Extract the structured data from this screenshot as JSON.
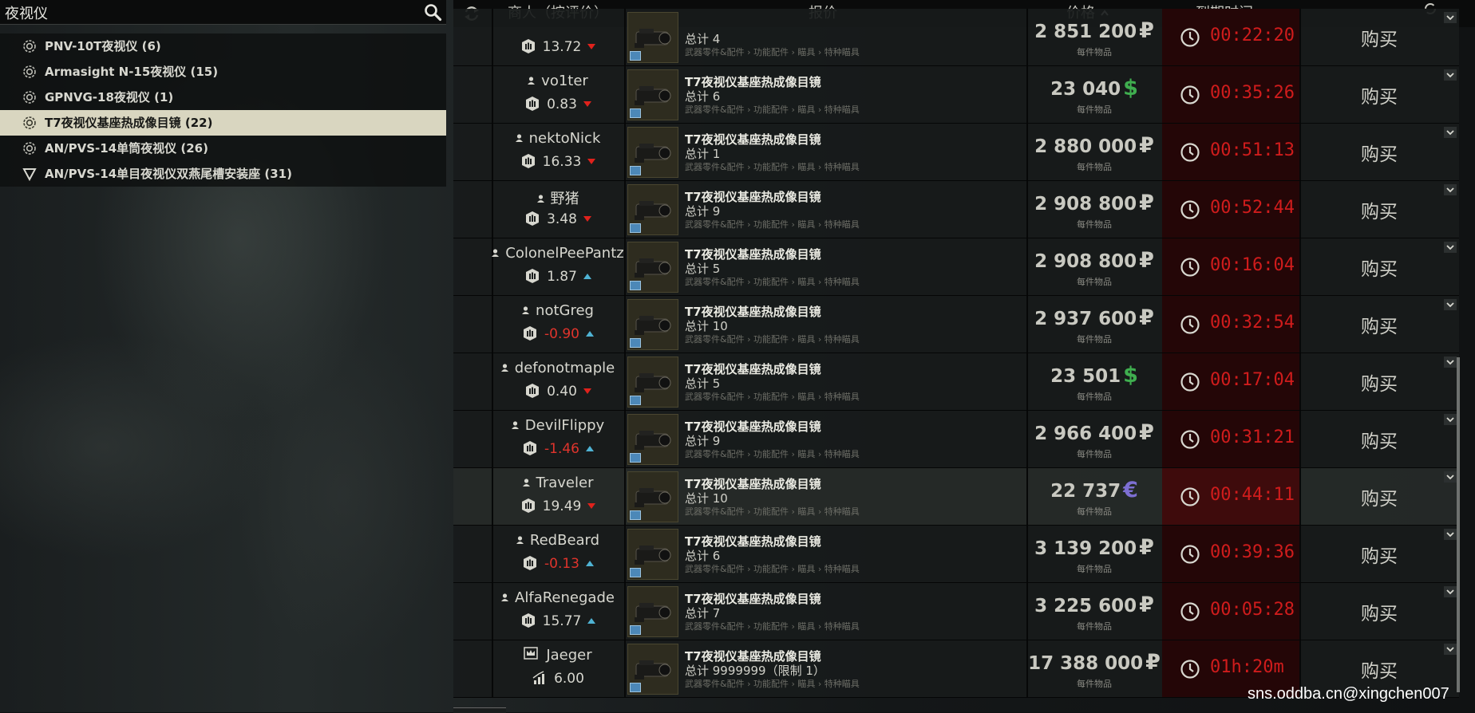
{
  "search": {
    "value": "夜视仪"
  },
  "categories": [
    {
      "label": "PNV-10T夜视仪 (6)",
      "icon": "gear-icon"
    },
    {
      "label": "Armasight N-15夜视仪 (15)",
      "icon": "gear-icon"
    },
    {
      "label": "GPNVG-18夜视仪 (1)",
      "icon": "gear-icon"
    },
    {
      "label": "T7夜视仪基座热成像目镜 (22)",
      "icon": "gear-icon",
      "selected": true
    },
    {
      "label": "AN/PVS-14单筒夜视仪 (26)",
      "icon": "gear-icon"
    },
    {
      "label": "AN/PVS-14单目夜视仪双燕尾槽安装座 (31)",
      "icon": "triangle-down-icon"
    }
  ],
  "header": {
    "trader": "商人（按评价）",
    "offer": "报价",
    "price": "价格",
    "expiry": "到期时间"
  },
  "colors": {
    "rub": "#c9c9c1",
    "usd": "#3fae4f",
    "eur": "#7d6fd2",
    "timer": "#d01c1c"
  },
  "offers": [
    {
      "trader": "",
      "rating": "13.72",
      "trend": "down",
      "negative": false,
      "item": "",
      "count": "总计 4",
      "category": "武器零件&配件 › 功能配件 › 瞄具 › 特种瞄具",
      "price": "2 851 200",
      "currency": "₽",
      "unit": "每件物品",
      "time": "00:22:20"
    },
    {
      "trader": "vo1ter",
      "rating": "0.83",
      "trend": "down",
      "negative": false,
      "item": "T7夜视仪基座热成像目镜",
      "count": "总计 6",
      "category": "武器零件&配件 › 功能配件 › 瞄具 › 特种瞄具",
      "price": "23 040",
      "currency": "$",
      "unit": "每件物品",
      "time": "00:35:26"
    },
    {
      "trader": "nektoNick",
      "rating": "16.33",
      "trend": "down",
      "negative": false,
      "item": "T7夜视仪基座热成像目镜",
      "count": "总计 1",
      "category": "武器零件&配件 › 功能配件 › 瞄具 › 特种瞄具",
      "price": "2 880 000",
      "currency": "₽",
      "unit": "每件物品",
      "time": "00:51:13"
    },
    {
      "trader": "野猪",
      "rating": "3.48",
      "trend": "down",
      "negative": false,
      "item": "T7夜视仪基座热成像目镜",
      "count": "总计 9",
      "category": "武器零件&配件 › 功能配件 › 瞄具 › 特种瞄具",
      "price": "2 908 800",
      "currency": "₽",
      "unit": "每件物品",
      "time": "00:52:44"
    },
    {
      "trader": "ColonelPeePantz",
      "rating": "1.87",
      "trend": "up",
      "negative": false,
      "item": "T7夜视仪基座热成像目镜",
      "count": "总计 5",
      "category": "武器零件&配件 › 功能配件 › 瞄具 › 特种瞄具",
      "price": "2 908 800",
      "currency": "₽",
      "unit": "每件物品",
      "time": "00:16:04"
    },
    {
      "trader": "notGreg",
      "rating": "-0.90",
      "trend": "up",
      "negative": true,
      "item": "T7夜视仪基座热成像目镜",
      "count": "总计 10",
      "category": "武器零件&配件 › 功能配件 › 瞄具 › 特种瞄具",
      "price": "2 937 600",
      "currency": "₽",
      "unit": "每件物品",
      "time": "00:32:54"
    },
    {
      "trader": "defonotmaple",
      "rating": "0.40",
      "trend": "down",
      "negative": false,
      "item": "T7夜视仪基座热成像目镜",
      "count": "总计 5",
      "category": "武器零件&配件 › 功能配件 › 瞄具 › 特种瞄具",
      "price": "23 501",
      "currency": "$",
      "unit": "每件物品",
      "time": "00:17:04"
    },
    {
      "trader": "DevilFlippy",
      "rating": "-1.46",
      "trend": "up",
      "negative": true,
      "item": "T7夜视仪基座热成像目镜",
      "count": "总计 9",
      "category": "武器零件&配件 › 功能配件 › 瞄具 › 特种瞄具",
      "price": "2 966 400",
      "currency": "₽",
      "unit": "每件物品",
      "time": "00:31:21"
    },
    {
      "trader": "Traveler",
      "rating": "19.49",
      "trend": "down",
      "negative": false,
      "item": "T7夜视仪基座热成像目镜",
      "count": "总计 10",
      "category": "武器零件&配件 › 功能配件 › 瞄具 › 特种瞄具",
      "price": "22 737",
      "currency": "€",
      "unit": "每件物品",
      "time": "00:44:11",
      "highlight": true
    },
    {
      "trader": "RedBeard",
      "rating": "-0.13",
      "trend": "up",
      "negative": true,
      "item": "T7夜视仪基座热成像目镜",
      "count": "总计 6",
      "category": "武器零件&配件 › 功能配件 › 瞄具 › 特种瞄具",
      "price": "3 139 200",
      "currency": "₽",
      "unit": "每件物品",
      "time": "00:39:36"
    },
    {
      "trader": "AlfaRenegade",
      "rating": "15.77",
      "trend": "up",
      "negative": false,
      "item": "T7夜视仪基座热成像目镜",
      "count": "总计 7",
      "category": "武器零件&配件 › 功能配件 › 瞄具 › 特种瞄具",
      "price": "3 225 600",
      "currency": "₽",
      "unit": "每件物品",
      "time": "00:05:28"
    },
    {
      "trader": "Jaeger",
      "rating": "6.00",
      "trend": "",
      "negative": false,
      "isTrader": true,
      "item": "T7夜视仪基座热成像目镜",
      "count": "总计 9999999（限制 1）",
      "category": "武器零件&配件 › 功能配件 › 瞄具 › 特种瞄具",
      "price": "17 388 000",
      "currency": "₽",
      "unit": "每件物品",
      "time": "01h:20m"
    }
  ],
  "buy_label": "购买",
  "watermark": "sns.oddba.cn@xingchen007"
}
